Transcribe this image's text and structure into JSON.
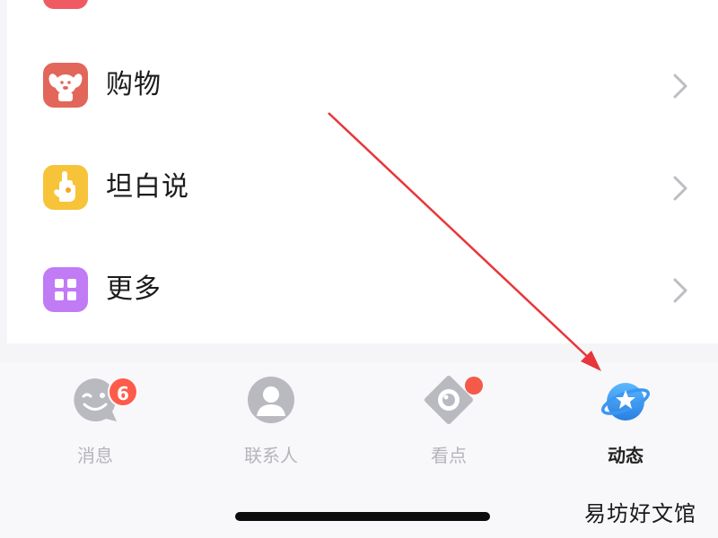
{
  "menu": {
    "items": [
      {
        "label": "购物",
        "icon": "shopping-dog-icon",
        "color": "#e2665a"
      },
      {
        "label": "坦白说",
        "icon": "raised-hand-icon",
        "color": "#f7c338"
      },
      {
        "label": "更多",
        "icon": "grid-icon",
        "color": "#c07bf5"
      }
    ]
  },
  "tabs": [
    {
      "label": "消息",
      "icon": "message-wink-icon",
      "badge": "6",
      "active": false
    },
    {
      "label": "联系人",
      "icon": "contact-person-icon",
      "active": false
    },
    {
      "label": "看点",
      "icon": "eye-icon",
      "active": false
    },
    {
      "label": "动态",
      "icon": "planet-star-icon",
      "active": true
    }
  ],
  "watermark": "易坊好文馆",
  "colors": {
    "arrow": "#e8363a",
    "badge": "#ff5b4b",
    "active_tab_icon": "#3a97f2",
    "inactive_tab": "#b4b4bb"
  }
}
